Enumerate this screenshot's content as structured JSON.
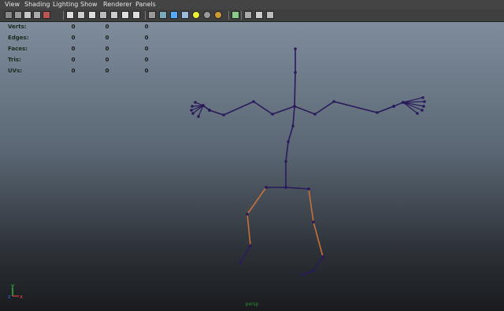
{
  "menu": [
    "View",
    "Shading",
    "Lighting",
    "Show",
    "Renderer",
    "Panels"
  ],
  "toolbar": {
    "icons": [
      "camera-icon",
      "camera-attr-icon",
      "bookmark-icon",
      "image-plane-icon",
      "2d-pan-icon",
      "grid-icon",
      "film-gate-icon",
      "resolution-gate-icon",
      "gate-mask-icon",
      "field-chart-icon",
      "safe-action-icon",
      "safe-title-icon",
      "wireframe-icon",
      "smooth-shade-icon",
      "shade-all-icon",
      "textured-icon",
      "use-all-lights-icon",
      "shadows-icon",
      "hq-render-icon",
      "isolate-select-icon",
      "xray-icon",
      "xray-joints-icon",
      "ambient-occlusion-icon"
    ]
  },
  "hud": {
    "rows": [
      {
        "label": "Verts:",
        "values": [
          "0",
          "0",
          "0"
        ]
      },
      {
        "label": "Edges:",
        "values": [
          "0",
          "0",
          "0"
        ]
      },
      {
        "label": "Faces:",
        "values": [
          "0",
          "0",
          "0"
        ]
      },
      {
        "label": "Tris:",
        "values": [
          "0",
          "0",
          "0"
        ]
      },
      {
        "label": "UVs:",
        "values": [
          "0",
          "0",
          "0"
        ]
      }
    ]
  },
  "camera": "persp",
  "axis": {
    "x": "x",
    "y": "y",
    "z": "z"
  },
  "colors": {
    "joint": "#2a1a5a",
    "bone_selected": "#c8703a",
    "axis_x": "#e04040",
    "axis_y": "#40d040",
    "axis_z": "#4060e0"
  }
}
